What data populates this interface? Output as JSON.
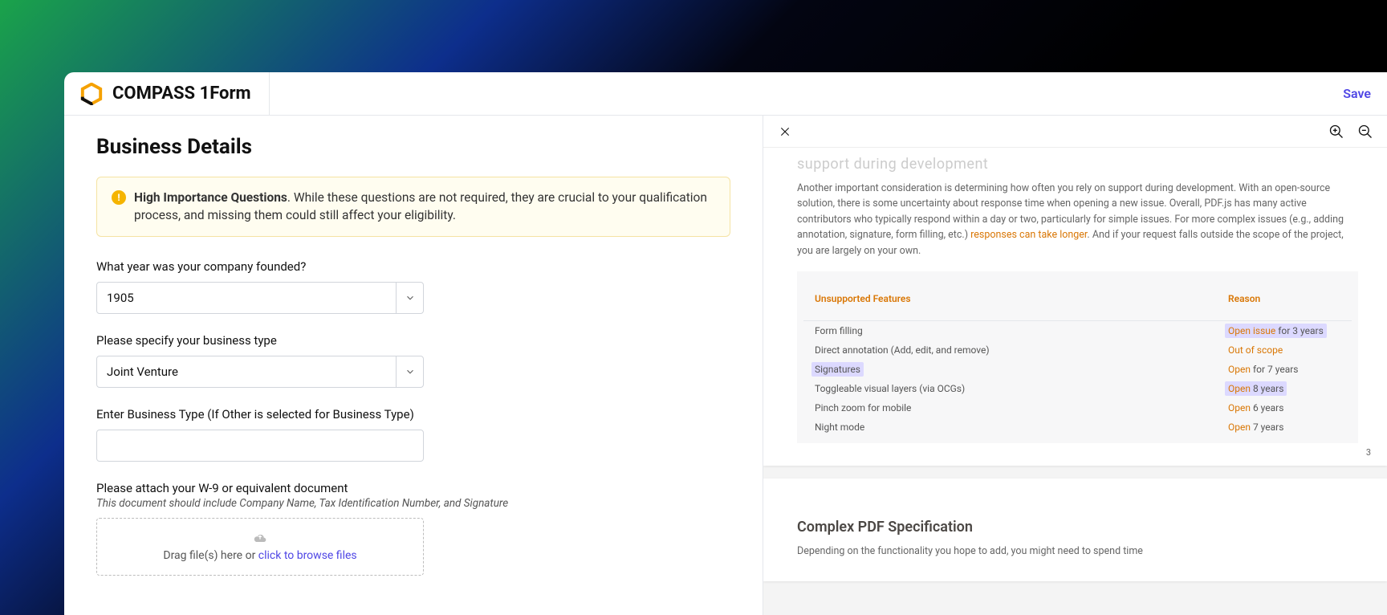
{
  "header": {
    "app_title": "COMPASS 1Form",
    "save_label": "Save"
  },
  "page": {
    "title": "Business Details"
  },
  "notice": {
    "title": "High Importance Questions",
    "body": ". While these questions are not required, they are crucial to your qualification process, and missing them could still affect your eligibility."
  },
  "fields": {
    "year_founded": {
      "label": "What year was your company founded?",
      "value": "1905"
    },
    "business_type": {
      "label": "Please specify your business type",
      "value": "Joint Venture"
    },
    "business_type_other": {
      "label": "Enter Business Type (If Other is selected for Business Type)",
      "value": ""
    },
    "w9": {
      "label": "Please attach your W-9 or equivalent document",
      "help": "This document should include Company Name, Tax Identification Number, and Signature",
      "drop_prefix": "Drag file(s) here or ",
      "drop_link": "click to browse files"
    }
  },
  "viewer": {
    "page_number": "3",
    "section1": {
      "ghost_heading": "support during development",
      "paragraph_before_link": "Another important consideration is determining how often you rely on support during development. With an open-source solution, there is some uncertainty about response time when opening a new issue. Overall, PDF.js has many active contributors who typically respond within a day or two, particularly for simple issues. For more complex issues (e.g., adding annotation, signature, form filling, etc.) ",
      "paragraph_link": "responses can take longer",
      "paragraph_after_link": ". And if your request falls outside the scope of the project, you are largely on your own."
    },
    "table": {
      "header": {
        "c1": "Unsupported Features",
        "c2": "Reason"
      },
      "rows": [
        {
          "feature": "Form filling",
          "status": "Open issue",
          "tail": " for 3 years",
          "hl_c2": true
        },
        {
          "feature": "Direct annotation (Add, edit, and remove)",
          "status": "Out of scope",
          "tail": ""
        },
        {
          "feature": "Signatures",
          "status": "Open",
          "tail": " for 7 years",
          "hl_c1": true
        },
        {
          "feature": "Toggleable visual layers (via OCGs)",
          "status": "Open",
          "tail": " 8 years",
          "hl_c2": true
        },
        {
          "feature": "Pinch zoom for mobile",
          "status": "Open",
          "tail": " 6 years"
        },
        {
          "feature": "Night mode",
          "status": "Open",
          "tail": " 7 years"
        }
      ]
    },
    "section2": {
      "heading": "Complex PDF Specification",
      "paragraph": "Depending on the functionality you hope to add, you might need to spend time"
    }
  }
}
